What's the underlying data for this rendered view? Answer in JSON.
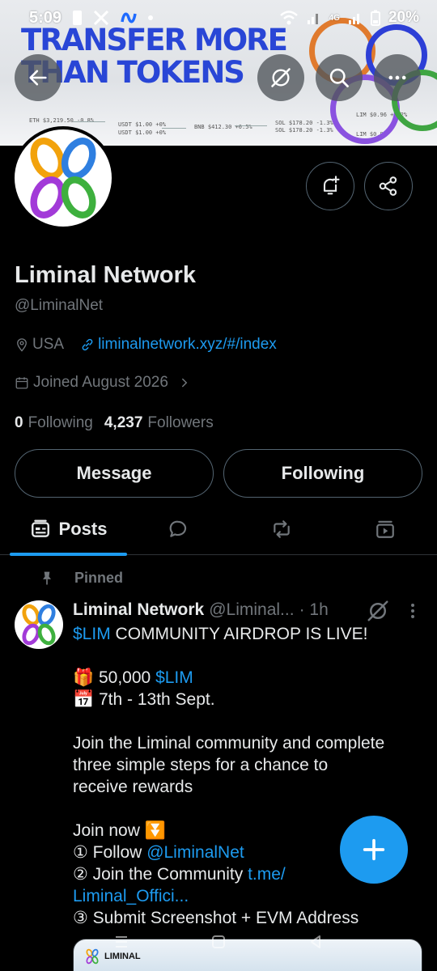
{
  "status_bar": {
    "time": "5:09",
    "battery": "20%",
    "network": "4G"
  },
  "banner": {
    "title_line1": "TRANSFER MORE",
    "title_line2": "THAN TOKENS",
    "tickers": [
      "ETH $3,219.50 -0.8%",
      "USDT $1.00 +0%",
      "USDT $1.00 +0%",
      "BNB $412.30 +0.5%",
      "SOL $178.20 -1.3%",
      "SOL $178.20 -1.3%",
      "LIM $0.96 +4.2%",
      "LIM $0.98"
    ]
  },
  "profile": {
    "name": "Liminal Network",
    "handle": "@LiminalNet",
    "location": "USA",
    "website": "liminalnetwork.xyz/#/index",
    "joined": "Joined August 2026",
    "following_count": "0",
    "following_label": "Following",
    "followers_count": "4,237",
    "followers_label": "Followers",
    "message_label": "Message",
    "follow_state_label": "Following"
  },
  "tabs": [
    {
      "label": "Posts"
    }
  ],
  "pinned_post": {
    "pinned_label": "Pinned",
    "author_name": "Liminal Network",
    "author_handle": "@Liminal...",
    "time": "· 1h",
    "line1_tag": "$LIM",
    "line1_rest": " COMMUNITY AIRDROP IS LIVE!",
    "line2_emoji": "🎁",
    "line2_amount": " 50,000 ",
    "line2_tag": "$LIM",
    "line3_emoji": "📅",
    "line3_text": " 7th - 13th Sept.",
    "para_1": "Join the Liminal community and complete",
    "para_2": "three simple steps for a chance to",
    "para_3": "receive rewards",
    "join_now": "Join now ⏬",
    "step1_prefix": "① Follow ",
    "step1_mention": "@LiminalNet",
    "step2_prefix": "② Join the Community ",
    "step2_link1": "t.me/",
    "step2_link2": "Liminal_Offici...",
    "step3": "③ Submit Screenshot + EVM Address",
    "media_logo": "LIMINAL"
  },
  "colors": {
    "accent": "#1d9bf0",
    "banner_title": "#2946d6",
    "background": "#000000",
    "muted": "#71767b"
  }
}
